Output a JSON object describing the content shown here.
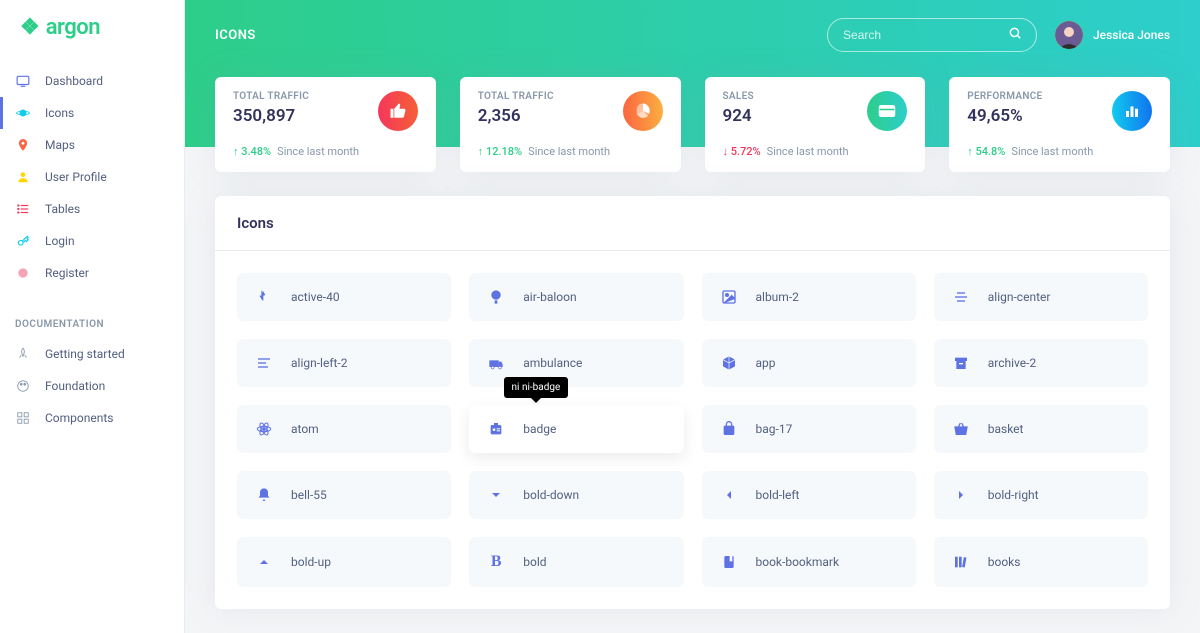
{
  "brand": "argon",
  "nav": {
    "items": [
      {
        "label": "Dashboard",
        "iconColor": "#5e72e4",
        "svg": "monitor"
      },
      {
        "label": "Icons",
        "iconColor": "#11cdef",
        "svg": "planet",
        "active": true
      },
      {
        "label": "Maps",
        "iconColor": "#fb6340",
        "svg": "pin"
      },
      {
        "label": "User Profile",
        "iconColor": "#ffd600",
        "svg": "user"
      },
      {
        "label": "Tables",
        "iconColor": "#f5365c",
        "svg": "list"
      },
      {
        "label": "Login",
        "iconColor": "#11cdef",
        "svg": "key"
      },
      {
        "label": "Register",
        "iconColor": "#f3a4b5",
        "svg": "circle"
      }
    ],
    "docHeader": "DOCUMENTATION",
    "docs": [
      {
        "label": "Getting started",
        "svg": "rocket"
      },
      {
        "label": "Foundation",
        "svg": "palette"
      },
      {
        "label": "Components",
        "svg": "grid"
      }
    ]
  },
  "header": {
    "title": "ICONS",
    "searchPlaceholder": "Search",
    "userName": "Jessica Jones"
  },
  "stats": [
    {
      "label": "TOTAL TRAFFIC",
      "value": "350,897",
      "change": "3.48%",
      "dir": "up",
      "since": "Since last month",
      "iconBg": "linear-gradient(87deg,#f5365c,#f56036)",
      "glyph": "thumb"
    },
    {
      "label": "TOTAL TRAFFIC",
      "value": "2,356",
      "change": "12.18%",
      "dir": "up",
      "since": "Since last month",
      "iconBg": "linear-gradient(87deg,#fb6340,#fbb140)",
      "glyph": "pie"
    },
    {
      "label": "SALES",
      "value": "924",
      "change": "5.72%",
      "dir": "down",
      "since": "Since last month",
      "iconBg": "linear-gradient(87deg,#2dce89,#2dcecc)",
      "glyph": "card"
    },
    {
      "label": "PERFORMANCE",
      "value": "49,65%",
      "change": "54.8%",
      "dir": "up",
      "since": "Since last month",
      "iconBg": "linear-gradient(87deg,#11cdef,#1171ef)",
      "glyph": "bars"
    }
  ],
  "panel": {
    "title": "Icons",
    "tooltip": "ni ni-badge",
    "icons": [
      {
        "name": "active-40",
        "glyph": "👆"
      },
      {
        "name": "air-baloon",
        "glyph": "💡"
      },
      {
        "name": "album-2",
        "glyph": "🖼"
      },
      {
        "name": "align-center",
        "glyph": "≡"
      },
      {
        "name": "align-left-2",
        "glyph": "≡"
      },
      {
        "name": "ambulance",
        "glyph": "🚑"
      },
      {
        "name": "app",
        "glyph": "📦"
      },
      {
        "name": "archive-2",
        "glyph": "🗄"
      },
      {
        "name": "atom",
        "glyph": "⚛"
      },
      {
        "name": "badge",
        "glyph": "🪪",
        "hovered": true
      },
      {
        "name": "bag-17",
        "glyph": "🛍"
      },
      {
        "name": "basket",
        "glyph": "🧺"
      },
      {
        "name": "bell-55",
        "glyph": "🔔"
      },
      {
        "name": "bold-down",
        "glyph": "⌄"
      },
      {
        "name": "bold-left",
        "glyph": "‹"
      },
      {
        "name": "bold-right",
        "glyph": "›"
      },
      {
        "name": "bold-up",
        "glyph": "⌃"
      },
      {
        "name": "bold",
        "glyph": "B"
      },
      {
        "name": "book-bookmark",
        "glyph": "📕"
      },
      {
        "name": "books",
        "glyph": "📚"
      }
    ]
  }
}
